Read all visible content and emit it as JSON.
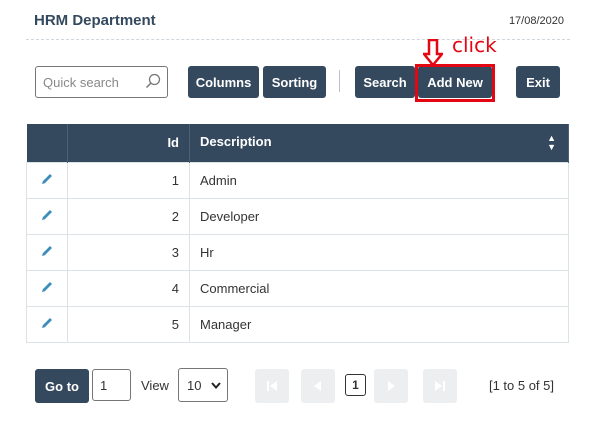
{
  "header": {
    "title": "HRM Department",
    "date": "17/08/2020"
  },
  "toolbar": {
    "search_placeholder": "Quick search",
    "columns_label": "Columns",
    "sorting_label": "Sorting",
    "search_label": "Search",
    "add_new_label": "Add New",
    "exit_label": "Exit"
  },
  "annotation": {
    "text": "click",
    "color": "#e30613"
  },
  "table": {
    "columns": [
      "Id",
      "Description"
    ],
    "rows": [
      {
        "id": "1",
        "description": "Admin"
      },
      {
        "id": "2",
        "description": "Developer"
      },
      {
        "id": "3",
        "description": "Hr"
      },
      {
        "id": "4",
        "description": "Commercial"
      },
      {
        "id": "5",
        "description": "Manager"
      }
    ]
  },
  "pager": {
    "goto_label": "Go to",
    "page_value": "1",
    "view_label": "View",
    "view_value": "10",
    "current_page": "1",
    "range_text": "[1 to 5 of 5]"
  },
  "colors": {
    "primary": "#34495e",
    "accent": "#e30613",
    "edit_icon": "#3c8dbc"
  }
}
